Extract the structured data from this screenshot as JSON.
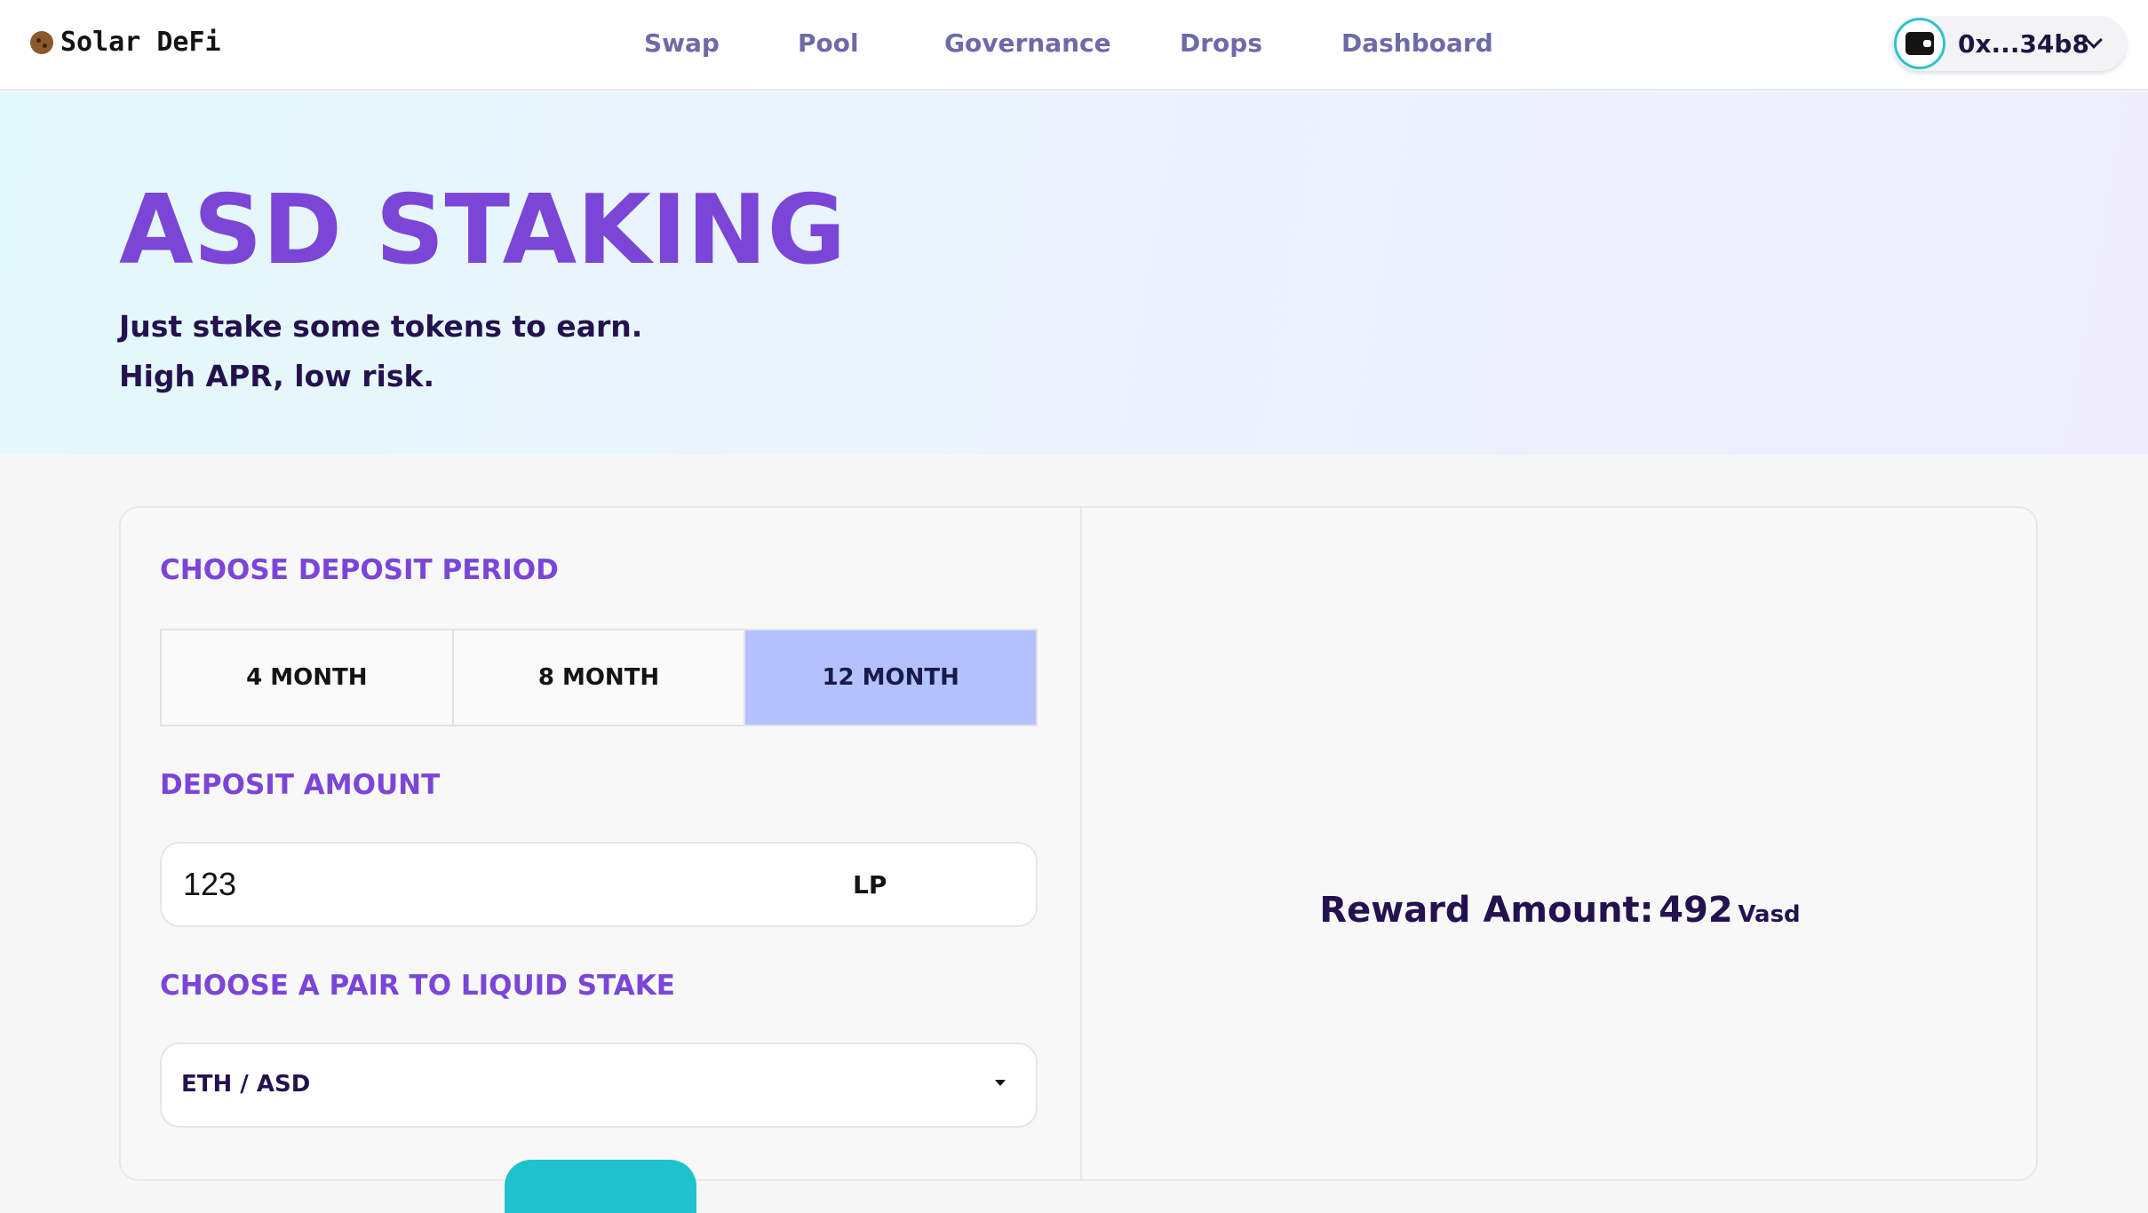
{
  "app": {
    "brand": "Solar DeFi"
  },
  "nav": {
    "items": [
      {
        "label": "Swap"
      },
      {
        "label": "Pool"
      },
      {
        "label": "Governance"
      },
      {
        "label": "Drops"
      },
      {
        "label": "Dashboard"
      }
    ]
  },
  "wallet": {
    "address": "0x...34b8",
    "icon": "wallet-icon"
  },
  "hero": {
    "title": "ASD STAKING",
    "subtitle_line1": "Just stake some tokens to earn.",
    "subtitle_line2": "High APR, low risk."
  },
  "staking": {
    "period_label": "CHOOSE DEPOSIT PERIOD",
    "periods": [
      {
        "label": "4 MONTH",
        "selected": false
      },
      {
        "label": "8 MONTH",
        "selected": false
      },
      {
        "label": "12 MONTH",
        "selected": true
      }
    ],
    "amount_label": "DEPOSIT AMOUNT",
    "amount_value": "123",
    "amount_unit": "LP",
    "pair_label": "CHOOSE A PAIR TO LIQUID STAKE",
    "pair_value": "ETH / ASD"
  },
  "reward": {
    "label": "Reward Amount:",
    "value": "492",
    "unit": "Vasd"
  },
  "colors": {
    "accent": "#7b45d8",
    "selected_period": "#b3c2fc",
    "primary_button": "#1fc2cc",
    "text_dark": "#24124e"
  }
}
